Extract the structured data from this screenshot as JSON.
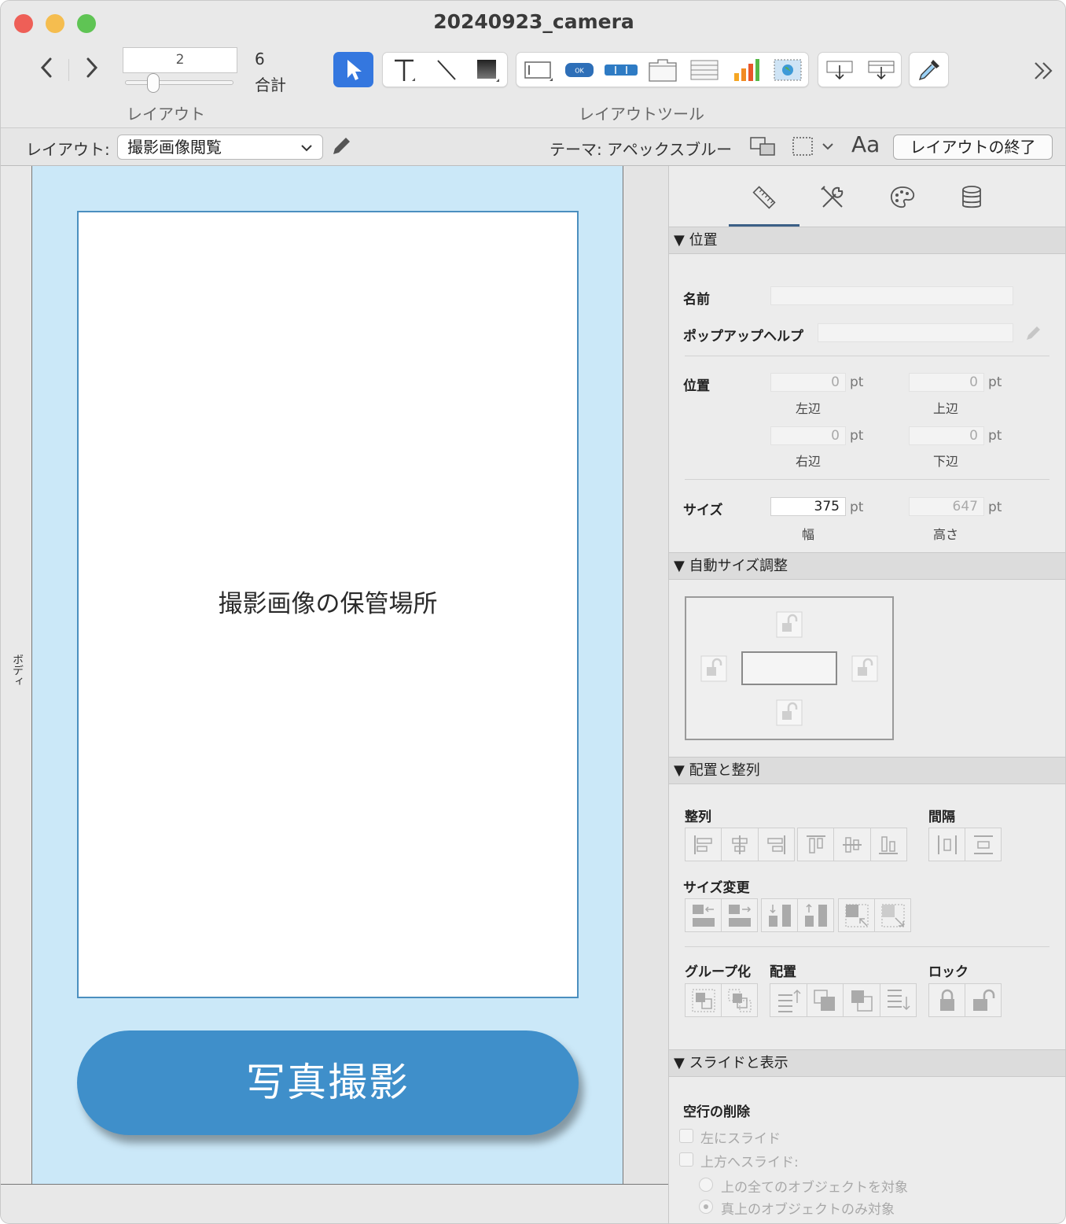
{
  "window": {
    "title": "20240923_camera",
    "traffic_lights": {
      "close": "#ee5f57",
      "minimize": "#f5bd4f",
      "zoom": "#5fc454"
    }
  },
  "toolbar": {
    "back_icon": "chevron-left-icon",
    "forward_icon": "chevron-right-icon",
    "record_value": "2",
    "total_count": "6",
    "total_label": "合計",
    "layout_caption": "レイアウト",
    "layout_tools_caption": "レイアウトツール",
    "overflow_icon": "double-chevron-right-icon",
    "selection_color": "#3477df"
  },
  "layout_bar": {
    "layout_label": "レイアウト:",
    "layout_value": "撮影画像閲覧",
    "theme_text": "テーマ: アペックスブルー",
    "font_icon_text": "Aa",
    "exit_button": "レイアウトの終了"
  },
  "canvas": {
    "part_label": "ボディ",
    "container_text": "撮影画像の保管場所",
    "photo_button": "写真撮影",
    "layout_bg": "#cbe8f8",
    "button_color": "#3f8fca"
  },
  "inspector": {
    "tabs": [
      "ruler-icon",
      "tools-icon",
      "palette-icon",
      "database-icon"
    ],
    "position_section": {
      "header": "▼ 位置",
      "name_label": "名前",
      "popup_help_label": "ポップアップヘルプ",
      "position_label": "位置",
      "left": {
        "value": "0",
        "unit": "pt",
        "caption": "左辺"
      },
      "top": {
        "value": "0",
        "unit": "pt",
        "caption": "上辺"
      },
      "right": {
        "value": "0",
        "unit": "pt",
        "caption": "右辺"
      },
      "bottom": {
        "value": "0",
        "unit": "pt",
        "caption": "下辺"
      },
      "size_label": "サイズ",
      "width": {
        "value": "375",
        "unit": "pt",
        "caption": "幅"
      },
      "height": {
        "value": "647",
        "unit": "pt",
        "caption": "高さ"
      }
    },
    "autosize_section": {
      "header": "▼ 自動サイズ調整"
    },
    "arrange_section": {
      "header": "▼ 配置と整列",
      "align_label": "整列",
      "spacing_label": "間隔",
      "resize_label": "サイズ変更",
      "group_label": "グループ化",
      "arrange_label": "配置",
      "lock_label": "ロック"
    },
    "slide_section": {
      "header": "▼ スライドと表示",
      "remove_blank_label": "空行の削除",
      "slide_left": "左にスライド",
      "slide_up": "上方へスライド:",
      "radio_all_above": "上の全てのオブジェクトを対象",
      "radio_directly_above": "真上のオブジェクトのみ対象"
    }
  }
}
